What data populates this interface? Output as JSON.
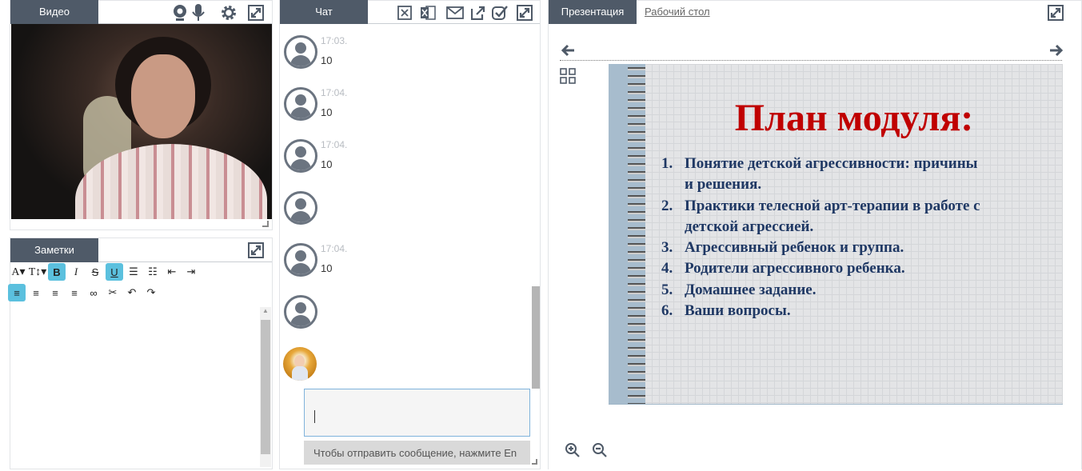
{
  "video_panel": {
    "tab_label": "Видео"
  },
  "notes_panel": {
    "tab_label": "Заметки",
    "toolbar_row1": [
      {
        "name": "font-size-dropdown",
        "glyph": "A▾",
        "active": false
      },
      {
        "name": "text-style-dropdown",
        "glyph": "T↕▾",
        "active": false
      },
      {
        "name": "bold-button",
        "glyph": "B",
        "active": true
      },
      {
        "name": "italic-button",
        "glyph": "I",
        "active": false
      },
      {
        "name": "strikethrough-button",
        "glyph": "S",
        "active": false
      },
      {
        "name": "underline-button",
        "glyph": "U",
        "active": true
      },
      {
        "name": "bullet-list-button",
        "glyph": "☰",
        "active": false
      },
      {
        "name": "numbered-list-button",
        "glyph": "☷",
        "active": false
      },
      {
        "name": "outdent-button",
        "glyph": "⇤",
        "active": false
      },
      {
        "name": "indent-button",
        "glyph": "⇥",
        "active": false
      }
    ],
    "toolbar_row2": [
      {
        "name": "align-left-button",
        "glyph": "≡",
        "active": true
      },
      {
        "name": "align-center-button",
        "glyph": "≡",
        "active": false
      },
      {
        "name": "align-right-button",
        "glyph": "≡",
        "active": false
      },
      {
        "name": "align-justify-button",
        "glyph": "≡",
        "active": false
      },
      {
        "name": "link-button",
        "glyph": "∞",
        "active": false
      },
      {
        "name": "unlink-button",
        "glyph": "✂",
        "active": false
      },
      {
        "name": "undo-button",
        "glyph": "↶",
        "active": false
      },
      {
        "name": "redo-button",
        "glyph": "↷",
        "active": false
      }
    ]
  },
  "chat_panel": {
    "tab_label": "Чат",
    "messages": [
      {
        "time": "17:03.",
        "text": "10"
      },
      {
        "time": "17:04.",
        "text": "10"
      },
      {
        "time": "17:04.",
        "text": "10"
      },
      {
        "time": "",
        "text": ""
      },
      {
        "time": "17:04.",
        "text": "10"
      },
      {
        "time": "",
        "text": ""
      }
    ],
    "input_value": "",
    "send_hint": "Чтобы отправить сообщение, нажмите En"
  },
  "presentation_panel": {
    "tabs": [
      {
        "label": "Презентация",
        "active": true
      },
      {
        "label": "Рабочий стол",
        "active": false
      }
    ],
    "slide": {
      "title": "План модуля:",
      "items": [
        {
          "n": "1.",
          "lines": [
            "Понятие детской агрессивности: причины",
            "и решения."
          ]
        },
        {
          "n": "2.",
          "lines": [
            "Практики телесной арт-терапии в работе с",
            "детской агрессией."
          ]
        },
        {
          "n": "3.",
          "lines": [
            "Агрессивный ребенок и группа."
          ]
        },
        {
          "n": "4.",
          "lines": [
            "Родители агрессивного ребенка."
          ]
        },
        {
          "n": "5.",
          "lines": [
            "Домашнее задание."
          ]
        },
        {
          "n": "6.",
          "lines": [
            "Ваши вопросы."
          ]
        }
      ]
    }
  },
  "colors": {
    "header_bg": "#4f5a68",
    "accent_active": "#5bc0de",
    "slide_title": "#c00000",
    "slide_text": "#1f3864"
  }
}
